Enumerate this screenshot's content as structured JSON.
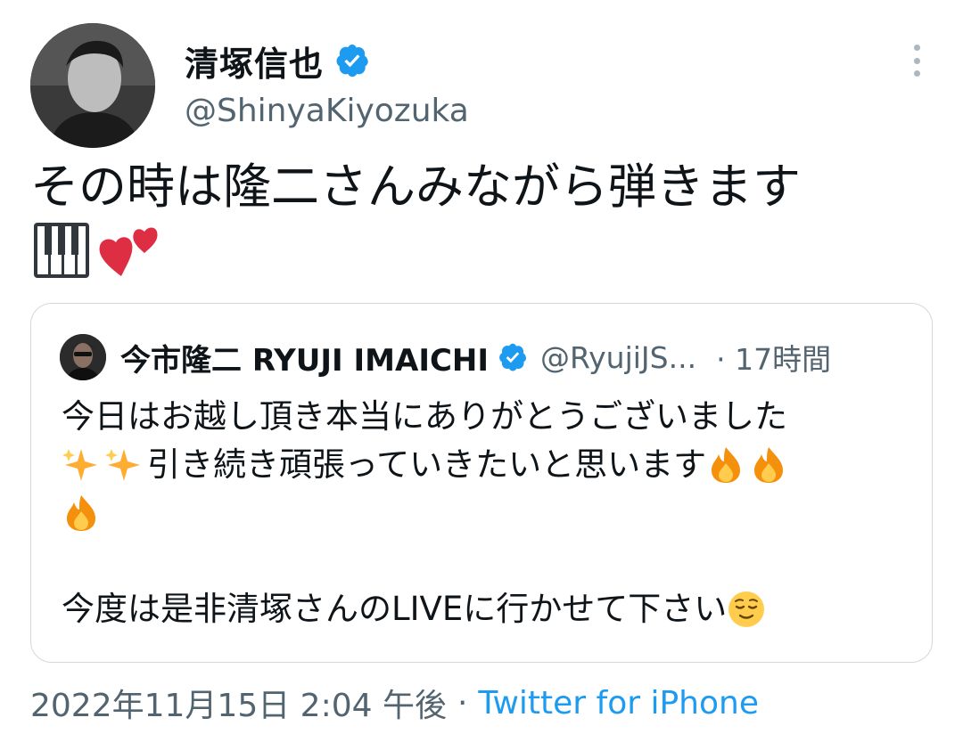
{
  "author": {
    "display_name": "清塚信也",
    "handle": "@ShinyaKiyozuka"
  },
  "tweet": {
    "text": "その時は隆二さんみながら弾きます",
    "emojis": [
      "piano-keys-emoji",
      "two-hearts-emoji"
    ]
  },
  "quote": {
    "display_name": "今市隆二 RYUJI IMAICHI",
    "handle": "@RyujiJS...",
    "time": "· 17時間",
    "lines": [
      "今日はお越し頂き本当にありがとうございました",
      "引き続き頑張っていきたいと思います",
      "",
      "",
      "今度は是非清塚さんのLIVEに行かせて下さい"
    ]
  },
  "footer": {
    "timestamp": "2022年11月15日 2:04 午後",
    "separator": "·",
    "source": "Twitter for iPhone"
  },
  "colors": {
    "verified": "#1d9bf0",
    "secondary_text": "#536471",
    "link": "#1d9bf0",
    "border": "#cfd9de"
  }
}
